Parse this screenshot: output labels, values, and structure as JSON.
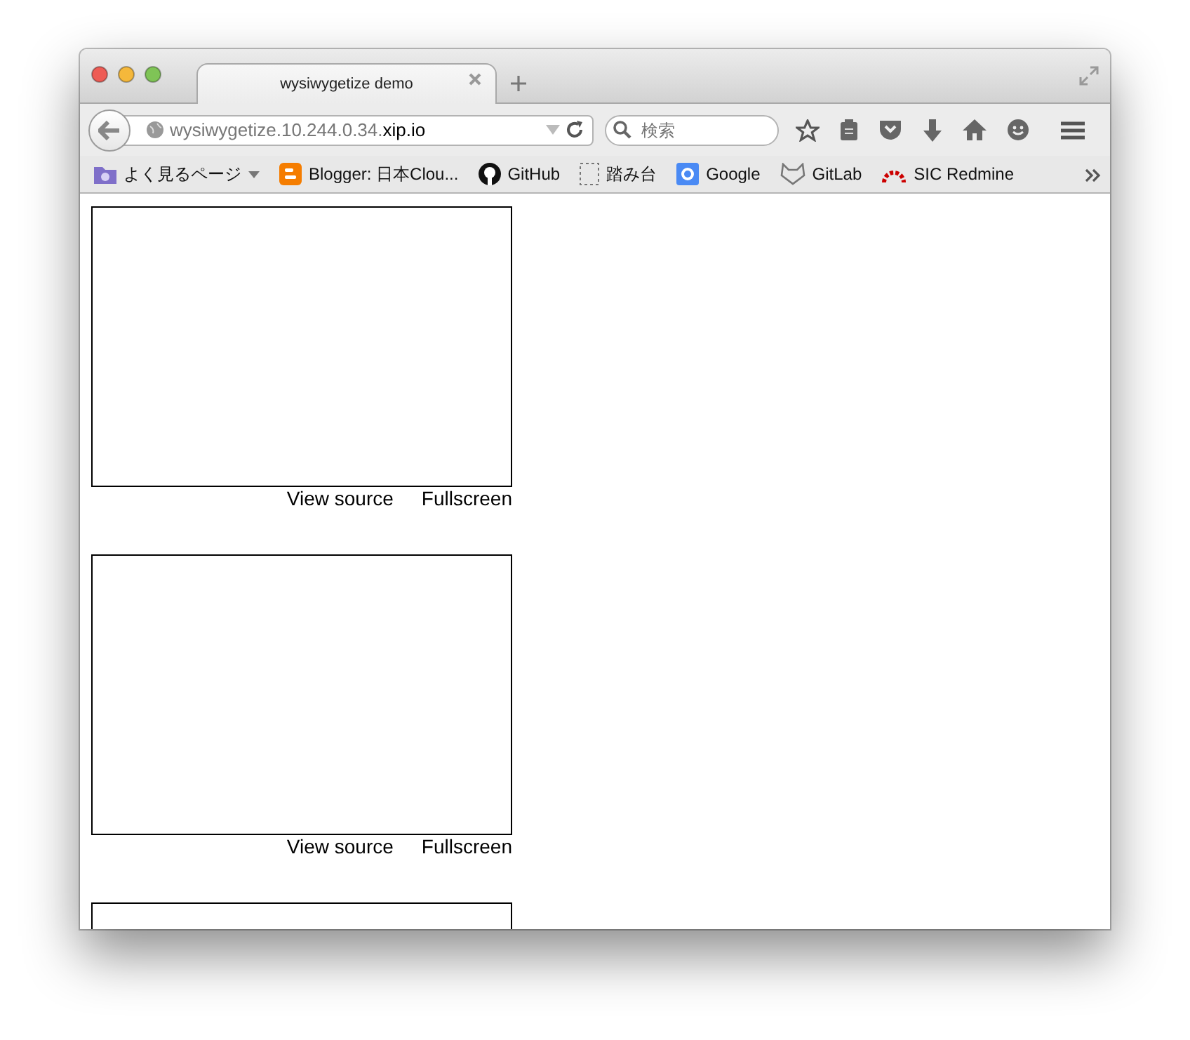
{
  "window": {
    "tab": {
      "title": "wysiwygetize demo",
      "selected": true
    }
  },
  "address": {
    "host": "wysiwygetize.10.244.0.34.",
    "domain": "xip.io"
  },
  "search": {
    "placeholder": "検索"
  },
  "bookmarks": [
    {
      "kind": "folder",
      "label": "よく見るページ"
    },
    {
      "kind": "blogger",
      "label": "Blogger: 日本Clou..."
    },
    {
      "kind": "github",
      "label": "GitHub"
    },
    {
      "kind": "blank",
      "label": "踏み台"
    },
    {
      "kind": "google",
      "label": "Google"
    },
    {
      "kind": "gitlab",
      "label": "GitLab"
    },
    {
      "kind": "redmine",
      "label": "SIC Redmine"
    }
  ],
  "editors": [
    {
      "kind": "editor",
      "links": [
        "View source",
        "Fullscreen"
      ]
    },
    {
      "kind": "editor",
      "links": [
        "View source",
        "Fullscreen"
      ]
    },
    {
      "kind": "editor"
    }
  ]
}
